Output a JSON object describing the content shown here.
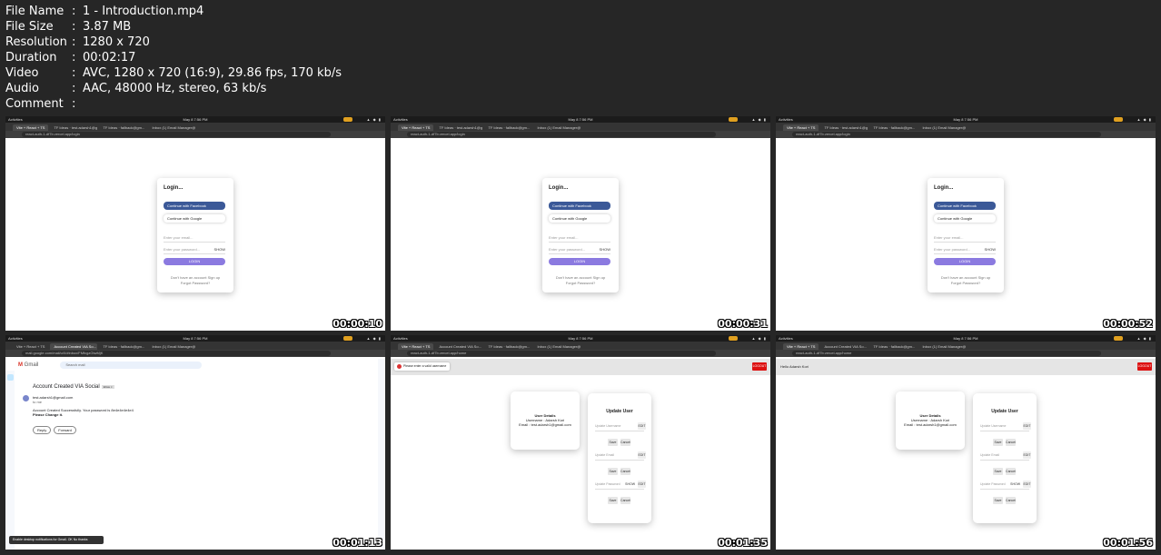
{
  "meta": [
    {
      "key": "File Name",
      "value": "1 - Introduction.mp4"
    },
    {
      "key": "File Size",
      "value": "3.87 MB"
    },
    {
      "key": "Resolution",
      "value": "1280 x 720"
    },
    {
      "key": "Duration",
      "value": "00:02:17"
    },
    {
      "key": "Video",
      "value": "AVC, 1280 x 720 (16:9), 29.86 fps, 170 kb/s"
    },
    {
      "key": "Audio",
      "value": "AAC, 48000 Hz, stereo, 63 kb/s"
    },
    {
      "key": "Comment",
      "value": ""
    }
  ],
  "meta_separator": ":",
  "frames": [
    {
      "timestamp": "00:00:10"
    },
    {
      "timestamp": "00:00:31"
    },
    {
      "timestamp": "00:00:52"
    },
    {
      "timestamp": "00:01:13"
    },
    {
      "timestamp": "00:01:35"
    },
    {
      "timestamp": "00:01:56"
    }
  ],
  "os": {
    "activities": "Activities",
    "clock": "May 8  7:56 PM"
  },
  "tabs": {
    "t1": "Vite + React + TS",
    "t2": "TF Ideas · test.adarsh1@g...",
    "t3": "TF Ideas · fallback@gm...",
    "t4": "Inbox (1) Email Manager@f..."
  },
  "gmail_tabs": {
    "t2": "Account Created VIA So..."
  },
  "urls": {
    "app": "react-auth-1-df7b.vercel.app/login",
    "app_home": "react-auth-1-df7b.vercel.app/home",
    "gmail": "mail.google.com/mail/u/0/#inbox/FMfcgzGtwMjK"
  },
  "login": {
    "title": "Login...",
    "facebook": "Continue with Facebook",
    "google": "Continue with Google",
    "email_placeholder": "Enter your email...",
    "password_placeholder": "Enter your password...",
    "show": "SHOW",
    "submit": "LOGIN",
    "signup": "Don't have an account Sign up",
    "forgot": "Forgot Password?"
  },
  "gmail": {
    "logo": "M",
    "logo_text": "Gmail",
    "search_placeholder": "Search mail",
    "subject": "Account Created VIA Social",
    "label": "Inbox ×",
    "from": "test.adarsh1@gmail.com",
    "to": "to me",
    "body_line1": "Account Created Successfully. Your password is 8e4e4e4e4e4",
    "body_line2": "Please Change it.",
    "reply": "Reply",
    "forward": "Forward",
    "toast": "Enable desktop notifications for Gmail.  OK   No thanks"
  },
  "app": {
    "alert": "Please enter a valid username",
    "hello": "Hello Adarsh Kori",
    "logout": "LOGOUT",
    "details_title": "User Details",
    "username_line": "Username : Adarsh Kori",
    "email_line": "Email : test.adarsh1@gmail.com",
    "update_title": "Update User",
    "update_username": "Update Username",
    "update_email": "Update Email",
    "update_password": "Update Password",
    "edit": "EDIT",
    "save": "Save",
    "cancel": "Cancel",
    "show": "SHOW"
  }
}
